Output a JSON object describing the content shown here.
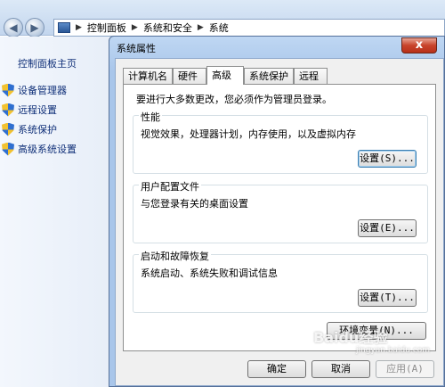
{
  "explorer": {
    "breadcrumbs": [
      "控制面板",
      "系统和安全",
      "系统"
    ],
    "sidebar": {
      "home": "控制面板主页",
      "items": [
        "设备管理器",
        "远程设置",
        "系统保护",
        "高级系统设置"
      ]
    }
  },
  "dialog": {
    "title": "系统属性",
    "close_glyph": "x",
    "tabs": [
      "计算机名",
      "硬件",
      "高级",
      "系统保护",
      "远程"
    ],
    "active_tab": "高级",
    "note": "要进行大多数更改，您必须作为管理员登录。",
    "groups": {
      "performance": {
        "title": "性能",
        "desc": "视觉效果，处理器计划，内存使用，以及虚拟内存",
        "button": "设置(S)..."
      },
      "profiles": {
        "title": "用户配置文件",
        "desc": "与您登录有关的桌面设置",
        "button": "设置(E)..."
      },
      "startup": {
        "title": "启动和故障恢复",
        "desc": "系统启动、系统失败和调试信息",
        "button": "设置(T)..."
      }
    },
    "env_button": "环境变量(N)...",
    "ok_button": "确定",
    "cancel_button": "取消",
    "apply_button": "应用(A)"
  },
  "watermark": {
    "text": "Baidu经验",
    "sub": "jingyan.baidu.com"
  },
  "colors": {
    "accent": "#0f2f78",
    "titlebar": "#a9c6ea",
    "close": "#c8432b"
  },
  "icons": [
    "back-arrow-icon",
    "forward-arrow-icon",
    "computer-icon",
    "shield-icon",
    "close-icon"
  ]
}
